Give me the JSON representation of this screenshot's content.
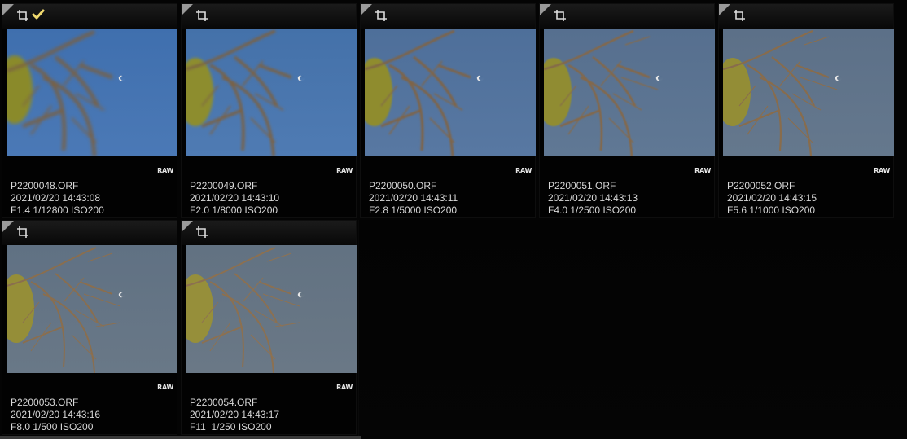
{
  "icons": {
    "crop": "crop-icon",
    "check": "check-icon",
    "corner": "corner-triangle"
  },
  "colors": {
    "check": "#f0d96e",
    "text": "#d8d8d8"
  },
  "tiles": [
    {
      "filename": "P2200048.ORF",
      "datetime": "2021/02/20 14:43:08",
      "exposure": "F1.4 1/12800 ISO200",
      "badge": "RAW",
      "checked": true,
      "sky": "#3f6fae",
      "sky2": "#4b79b6"
    },
    {
      "filename": "P2200049.ORF",
      "datetime": "2021/02/20 14:43:10",
      "exposure": "F2.0 1/8000 ISO200",
      "badge": "RAW",
      "checked": false,
      "sky": "#4471a9",
      "sky2": "#4f7bb3"
    },
    {
      "filename": "P2200050.ORF",
      "datetime": "2021/02/20 14:43:11",
      "exposure": "F2.8 1/5000 ISO200",
      "badge": "RAW",
      "checked": false,
      "sky": "#4e6f9a",
      "sky2": "#5878a2"
    },
    {
      "filename": "P2200051.ORF",
      "datetime": "2021/02/20 14:43:13",
      "exposure": "F4.0 1/2500 ISO200",
      "badge": "RAW",
      "checked": false,
      "sky": "#566f8f",
      "sky2": "#607894"
    },
    {
      "filename": "P2200052.ORF",
      "datetime": "2021/02/20 14:43:15",
      "exposure": "F5.6 1/1000 ISO200",
      "badge": "RAW",
      "checked": false,
      "sky": "#5c7088",
      "sky2": "#65788d"
    },
    {
      "filename": "P2200053.ORF",
      "datetime": "2021/02/20 14:43:16",
      "exposure": "F8.0 1/500 ISO200",
      "badge": "RAW",
      "checked": false,
      "sky": "#607183",
      "sky2": "#697887"
    },
    {
      "filename": "P2200054.ORF",
      "datetime": "2021/02/20 14:43:17",
      "exposure": "F11  1/250 ISO200",
      "badge": "RAW",
      "checked": false,
      "sky": "#627282",
      "sky2": "#6a7886"
    }
  ]
}
